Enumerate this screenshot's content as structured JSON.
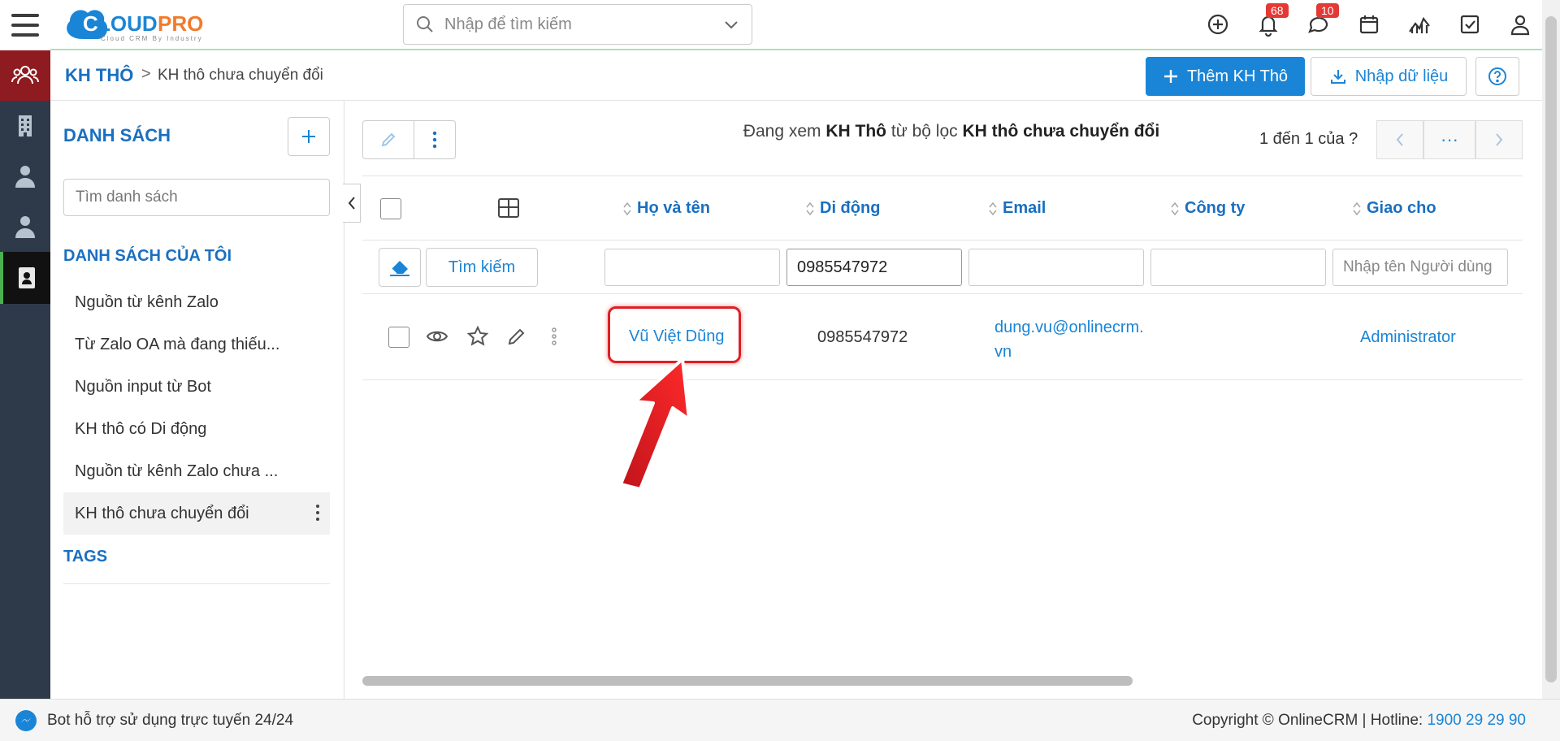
{
  "app": {
    "logo_text": "CLOUDPRO",
    "logo_tagline": "Cloud CRM By Industry"
  },
  "search": {
    "placeholder": "Nhập để tìm kiếm"
  },
  "header": {
    "notifications_count": "68",
    "messages_count": "10"
  },
  "breadcrumb": {
    "module": "KH THÔ",
    "separator": ">",
    "current": "KH thô chưa chuyển đổi"
  },
  "actions": {
    "add_label": "Thêm KH Thô",
    "import_label": "Nhập dữ liệu"
  },
  "sidebar": {
    "title": "DANH SÁCH",
    "search_placeholder": "Tìm danh sách",
    "my_lists_title": "DANH SÁCH CỦA TÔI",
    "items": [
      {
        "label": "Nguồn từ kênh Zalo"
      },
      {
        "label": "Từ Zalo OA mà đang thiếu..."
      },
      {
        "label": "Nguồn input từ Bot"
      },
      {
        "label": "KH thô có Di động"
      },
      {
        "label": "Nguồn từ kênh Zalo chưa ..."
      },
      {
        "label": "KH thô chưa chuyển đổi"
      }
    ],
    "tags_title": "TAGS"
  },
  "main": {
    "viewing_prefix": "Đang xem",
    "viewing_module": "KH Thô",
    "viewing_mid": "từ bộ lọc",
    "viewing_filter": "KH thô chưa chuyển đổi",
    "pager_text": "1 đến 1 của",
    "pager_unknown": "?",
    "pager_more": "···"
  },
  "table": {
    "columns": [
      "Họ và tên",
      "Di động",
      "Email",
      "Công ty",
      "Giao cho"
    ],
    "filter": {
      "search_label": "Tìm kiếm",
      "mobile_value": "0985547972",
      "assignee_placeholder": "Nhập tên Người dùng"
    },
    "rows": [
      {
        "name": "Vũ Việt Dũng",
        "mobile": "0985547972",
        "email_line1": "dung.vu@onlinecrm.",
        "email_line2": "vn",
        "company": "",
        "assignee": "Administrator"
      }
    ]
  },
  "footer": {
    "bot_text": "Bot hỗ trợ sử dụng trực tuyến 24/24",
    "copyright": "Copyright © OnlineCRM",
    "hotline_label": "Hotline:",
    "hotline_number": "1900 29 29 90"
  },
  "colors": {
    "primary": "#1a85d6",
    "rail": "#2e3a4a",
    "rail_active": "#8e1b1f",
    "highlight": "#e01e25"
  }
}
